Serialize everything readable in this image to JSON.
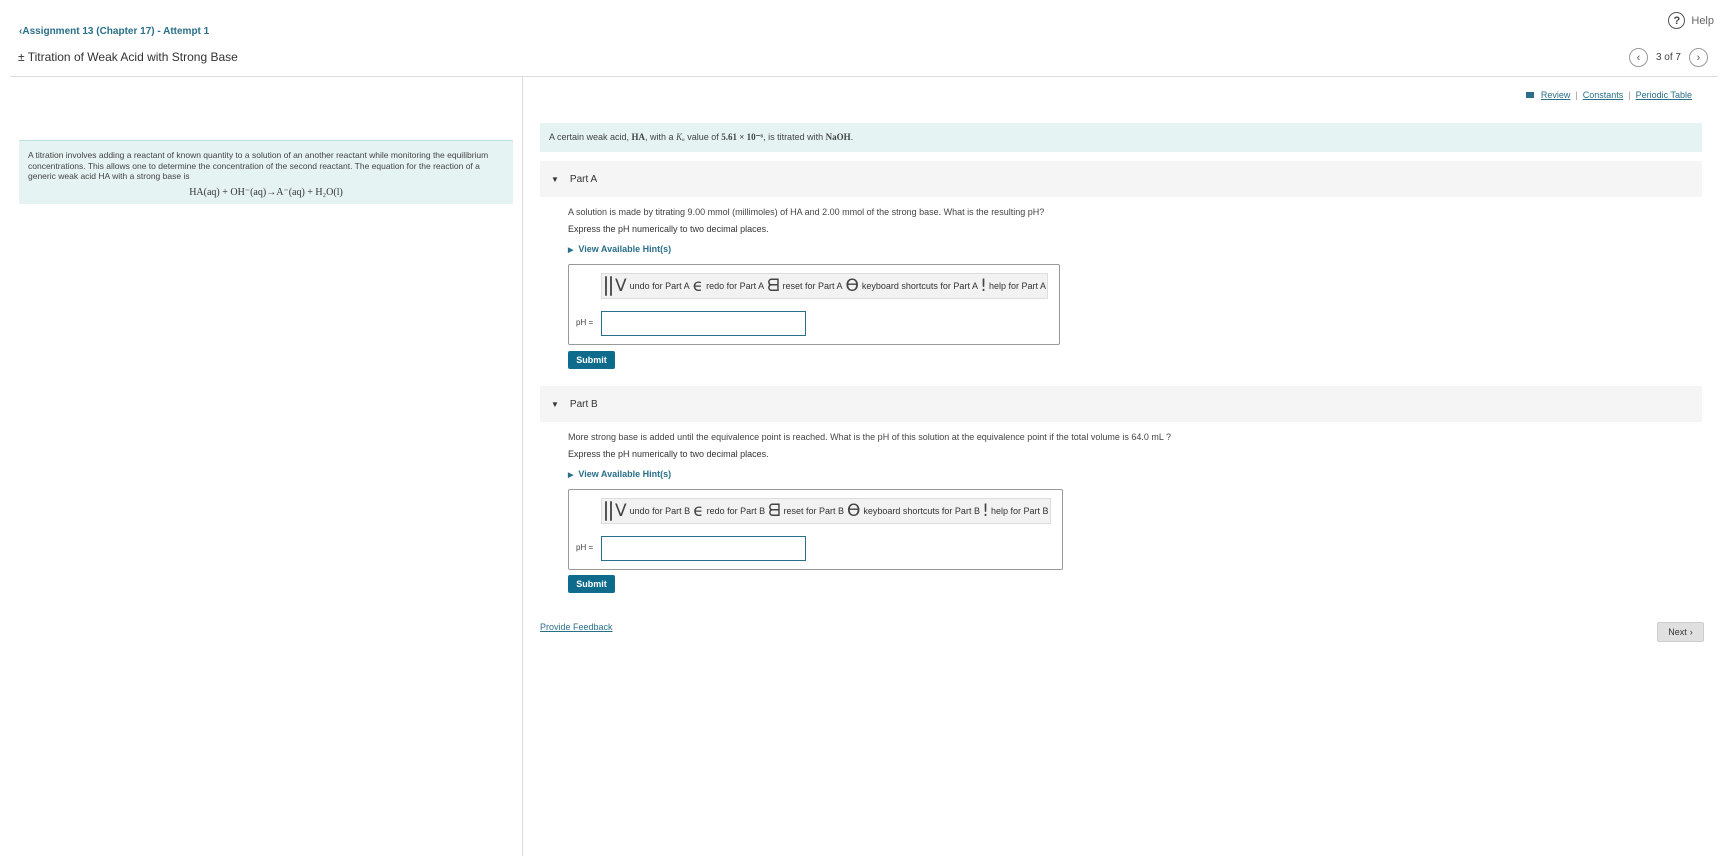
{
  "header": {
    "help_label": "Help",
    "help_icon": "?",
    "assignment_link": "Assignment 13 (Chapter 17) - Attempt 1",
    "back_chevron": "‹",
    "title": "± Titration of Weak Acid with Strong Base",
    "pager": {
      "prev": "‹",
      "text": "3 of 7",
      "next": "›"
    }
  },
  "intro": {
    "text": "A titration involves adding a reactant of known quantity to a solution of an another reactant while monitoring the equilibrium concentrations. This allows one to determine the concentration of the second reactant. The equation for the reaction of a generic weak acid HA with a strong base is",
    "equation": "HA(aq) + OH⁻(aq)→A⁻(aq) + H₂O(l)"
  },
  "resources": {
    "review": "Review",
    "constants": "Constants",
    "periodic_table": "Periodic Table",
    "separator": "|"
  },
  "problem": {
    "pre": "A certain weak acid, ",
    "ha": "HA",
    "mid": ", with a ",
    "ka": "Kₐ",
    "mid2": " value of ",
    "ka_value": "5.61 × 10⁻⁶",
    "post": ", is titrated with ",
    "base": "NaOH",
    "end": "."
  },
  "parts": [
    {
      "label": "Part A",
      "question": "A solution is made by titrating 9.00 mmol (millimoles) of HA and 2.00 mmol of the strong base. What is the resulting pH?",
      "instruction": "Express the pH numerically to two decimal places.",
      "hint": "View Available Hint(s)",
      "toolbar": {
        "btn1": "for Part A",
        "btn2": "for Part A",
        "g1": "V",
        "undo": "undo for Part A",
        "g2": "ϵ",
        "redo": "redo for Part A",
        "g3": "ᗺ",
        "reset": "reset for Part A",
        "g4": "ϴ",
        "keyboard": "keyboard shortcuts for Part A",
        "g5": "ǃ",
        "help": "help for Part A"
      },
      "ph_label": "pH =",
      "value": "",
      "submit": "Submit"
    },
    {
      "label": "Part B",
      "question": "More strong base is added until the equivalence point is reached. What is the pH of this solution at the equivalence point if the total volume is 64.0 mL ?",
      "instruction": "Express the pH numerically to two decimal places.",
      "hint": "View Available Hint(s)",
      "toolbar": {
        "btn1": "for Part B",
        "btn2": "for Part B",
        "g1": "V",
        "undo": "undo for Part B",
        "g2": "ϵ",
        "redo": "redo for Part B",
        "g3": "ᗺ",
        "reset": "reset for Part B",
        "g4": "ϴ",
        "keyboard": "keyboard shortcuts for Part B",
        "g5": "ǃ",
        "help": "help for Part B"
      },
      "ph_label": "pH =",
      "value": "",
      "submit": "Submit"
    }
  ],
  "footer": {
    "feedback": "Provide Feedback",
    "next": "Next",
    "next_icon": "›"
  },
  "colors": {
    "link": "#2a6f8a",
    "submit_bg": "#0f6b8c",
    "panel_bg": "#e5f3f2"
  }
}
